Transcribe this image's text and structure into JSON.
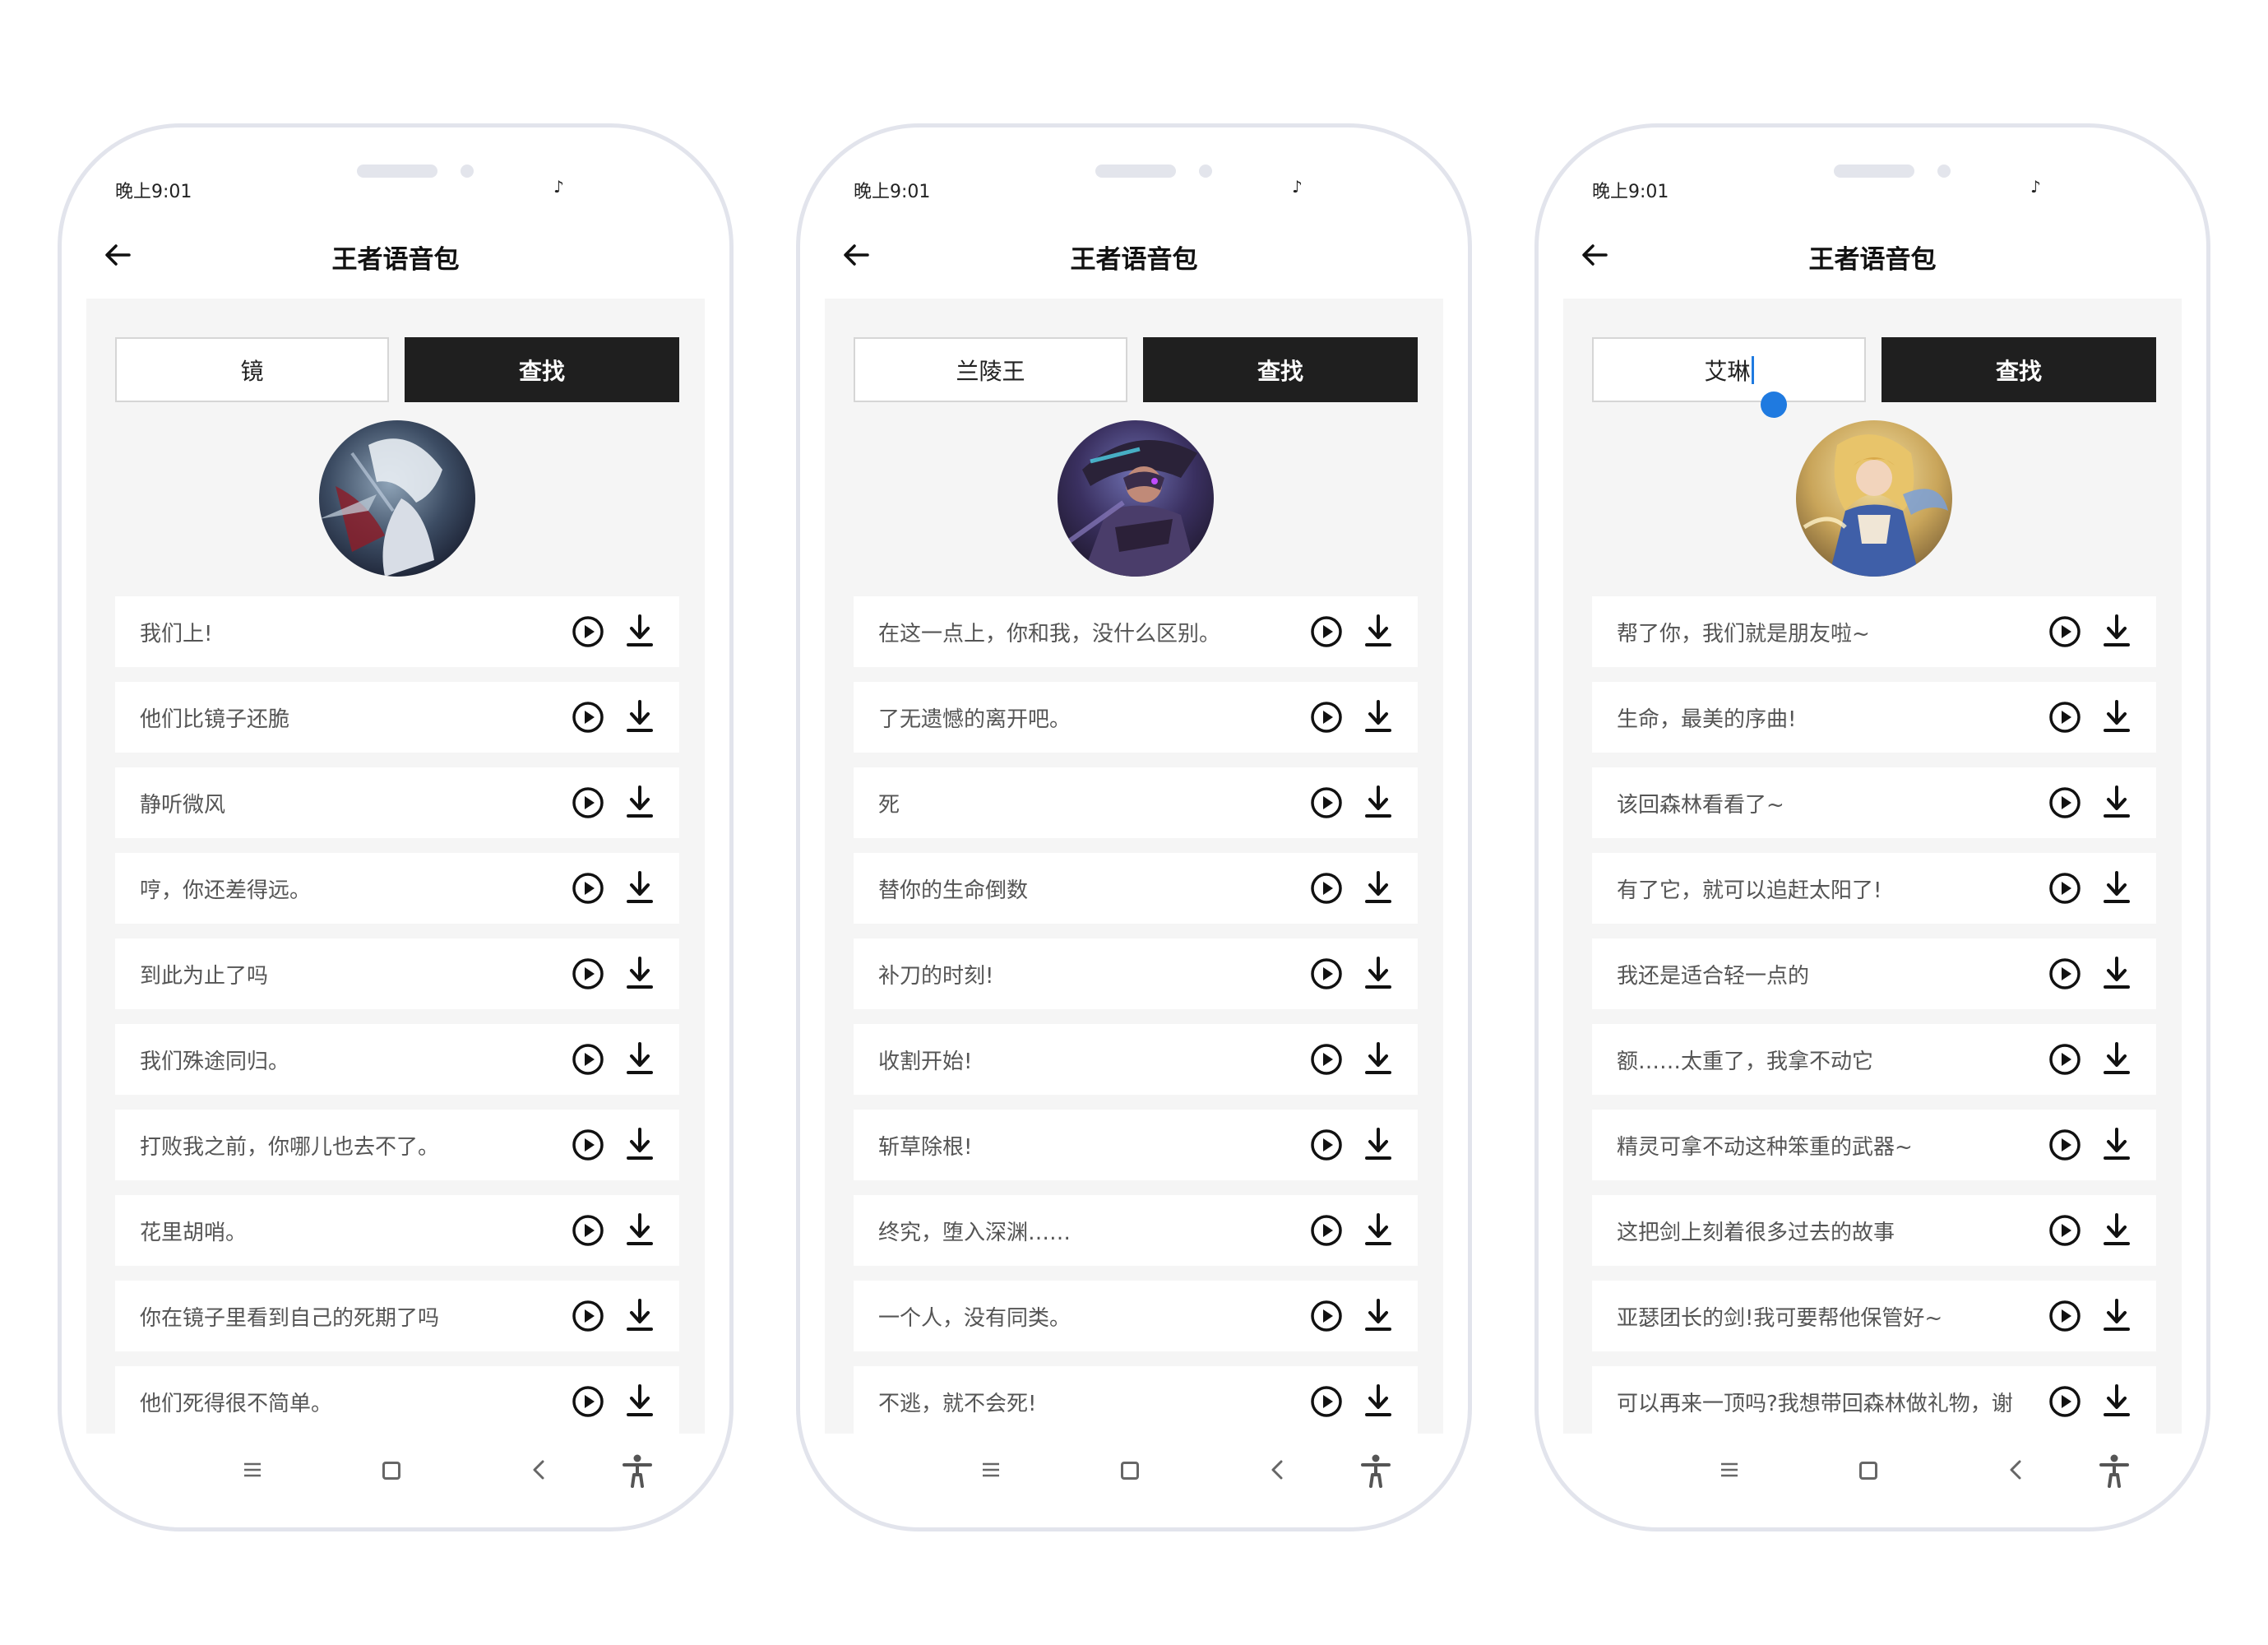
{
  "app": {
    "status_time": "晚上9:01",
    "status_icon": "♪",
    "title": "王者语音包",
    "search_button_label": "查找"
  },
  "icons": {
    "back": "arrow-left-icon",
    "play": "play-circle-icon",
    "download": "download-icon",
    "menu": "menu-icon",
    "home": "home-square-icon",
    "nav_back": "chevron-left-icon",
    "accessibility": "accessibility-icon"
  },
  "colors": {
    "accent_dark": "#1f1f1f",
    "background_gray": "#f5f5f5",
    "cursor_blue": "#1f7ae0",
    "phone_border": "#e2e4ec"
  },
  "screens": [
    {
      "search_value": "镜",
      "voices": [
        "我们上!",
        "他们比镜子还脆",
        "静听微风",
        "哼，你还差得远。",
        "到此为止了吗",
        "我们殊途同归。",
        "打败我之前，你哪儿也去不了。",
        "花里胡哨。",
        "你在镜子里看到自己的死期了吗",
        "他们死得很不简单。"
      ]
    },
    {
      "search_value": "兰陵王",
      "voices": [
        "在这一点上，你和我，没什么区别。",
        "了无遗憾的离开吧。",
        "死",
        "替你的生命倒数",
        "补刀的时刻!",
        "收割开始!",
        "斩草除根!",
        "终究，堕入深渊……",
        "一个人，没有同类。",
        "不逃，就不会死!"
      ]
    },
    {
      "search_value": "艾琳",
      "voices": [
        "帮了你，我们就是朋友啦~",
        "生命，最美的序曲!",
        "该回森林看看了~",
        "有了它，就可以追赶太阳了!",
        "我还是适合轻一点的",
        "额……太重了，我拿不动它",
        "精灵可拿不动这种笨重的武器~",
        "这把剑上刻着很多过去的故事",
        "亚瑟团长的剑!我可要帮他保管好~",
        "可以再来一顶吗?我想带回森林做礼物，谢"
      ]
    }
  ]
}
